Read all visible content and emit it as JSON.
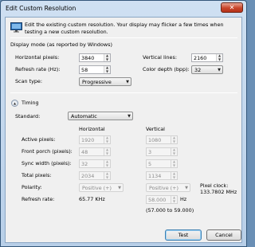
{
  "window": {
    "title": "Edit Custom Resolution",
    "close_glyph": "✕"
  },
  "intro": {
    "icon": "monitor-icon",
    "text": "Edit the existing custom resolution. Your display may flicker a few times when testing a new custom resolution."
  },
  "display_mode": {
    "heading": "Display mode (as reported by Windows)",
    "horizontal_pixels": {
      "label": "Horizontal pixels:",
      "value": "3840"
    },
    "vertical_lines": {
      "label": "Vertical lines:",
      "value": "2160"
    },
    "refresh_rate": {
      "label": "Refresh rate (Hz):",
      "value": "58"
    },
    "color_depth": {
      "label": "Color depth (bpp):",
      "value": "32"
    },
    "scan_type": {
      "label": "Scan type:",
      "value": "Progressive"
    }
  },
  "timing": {
    "heading": "Timing",
    "standard": {
      "label": "Standard:",
      "value": "Automatic"
    },
    "col_horizontal": "Horizontal",
    "col_vertical": "Vertical",
    "active_pixels": {
      "label": "Active pixels:",
      "h": "1920",
      "v": "1080"
    },
    "front_porch": {
      "label": "Front porch (pixels):",
      "h": "48",
      "v": "3"
    },
    "sync_width": {
      "label": "Sync width (pixels):",
      "h": "32",
      "v": "5"
    },
    "total_pixels": {
      "label": "Total pixels:",
      "h": "2034",
      "v": "1134"
    },
    "polarity": {
      "label": "Polarity:",
      "h": "Positive (+)",
      "v": "Positive (+)"
    },
    "pixel_clock": {
      "label": "Pixel clock:",
      "value": "133.7802 MHz"
    },
    "refresh_rate": {
      "label": "Refresh rate:",
      "h": "65.77 KHz",
      "v": "58.000",
      "v_unit": "Hz",
      "range": "(57.000 to 59.000)"
    }
  },
  "buttons": {
    "test": "Test",
    "cancel": "Cancel"
  },
  "colors": {
    "titlebar": "#cfe0f2",
    "close": "#c9452a",
    "default_button_border": "#3c7fb1"
  }
}
